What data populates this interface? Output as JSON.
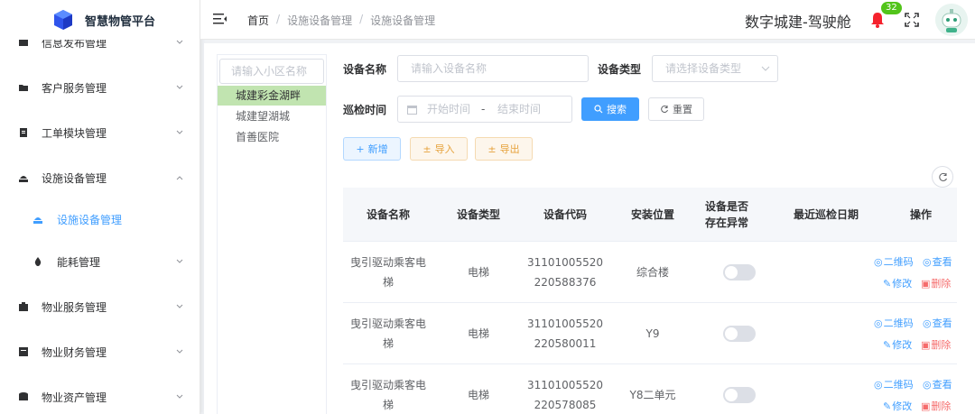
{
  "app": {
    "title": "智慧物管平台",
    "system_name": "数字城建-驾驶舱",
    "notification_count": "32"
  },
  "sidebar": {
    "items": [
      {
        "label": "信息发布管理"
      },
      {
        "label": "客户服务管理"
      },
      {
        "label": "工单模块管理"
      },
      {
        "label": "设施设备管理"
      },
      {
        "label": "设施设备管理"
      },
      {
        "label": "能耗管理"
      },
      {
        "label": "物业服务管理"
      },
      {
        "label": "物业财务管理"
      },
      {
        "label": "物业资产管理"
      }
    ]
  },
  "breadcrumb": {
    "home": "首页",
    "sep": "/",
    "level1": "设施设备管理",
    "level2": "设施设备管理"
  },
  "tree": {
    "search_placeholder": "请输入小区名称",
    "nodes": [
      {
        "label": "城建彩金湖畔"
      },
      {
        "label": "城建望湖城"
      },
      {
        "label": "首善医院"
      }
    ]
  },
  "filters": {
    "device_name_label": "设备名称",
    "device_name_placeholder": "请输入设备名称",
    "device_type_label": "设备类型",
    "device_type_placeholder": "请选择设备类型",
    "inspect_time_label": "巡检时间",
    "start_placeholder": "开始时间",
    "date_sep": "-",
    "end_placeholder": "结束时间",
    "search_label": "搜索",
    "reset_label": "重置"
  },
  "toolbar": {
    "add_label": "新增",
    "import_label": "导入",
    "export_label": "导出"
  },
  "table": {
    "columns": [
      "设备名称",
      "设备类型",
      "设备代码",
      "安装位置",
      "设备是否存在异常",
      "最近巡检日期",
      "操作"
    ],
    "rows": [
      {
        "name": "曳引驱动乘客电梯",
        "type": "电梯",
        "code": "31101005520220588376",
        "location": "综合楼",
        "last_date": ""
      },
      {
        "name": "曳引驱动乘客电梯",
        "type": "电梯",
        "code": "31101005520220580011",
        "location": "Y9",
        "last_date": ""
      },
      {
        "name": "曳引驱动乘客电梯",
        "type": "电梯",
        "code": "31101005520220578085",
        "location": "Y8二单元",
        "last_date": ""
      }
    ],
    "ops": {
      "qrcode": "二维码",
      "view": "查看",
      "edit": "修改",
      "delete": "删除"
    }
  },
  "colors": {
    "primary": "#409eff",
    "selected_node": "#c1e4b0",
    "warning": "#e6a23c",
    "danger": "#f56c6c",
    "badge": "#52c41a"
  }
}
